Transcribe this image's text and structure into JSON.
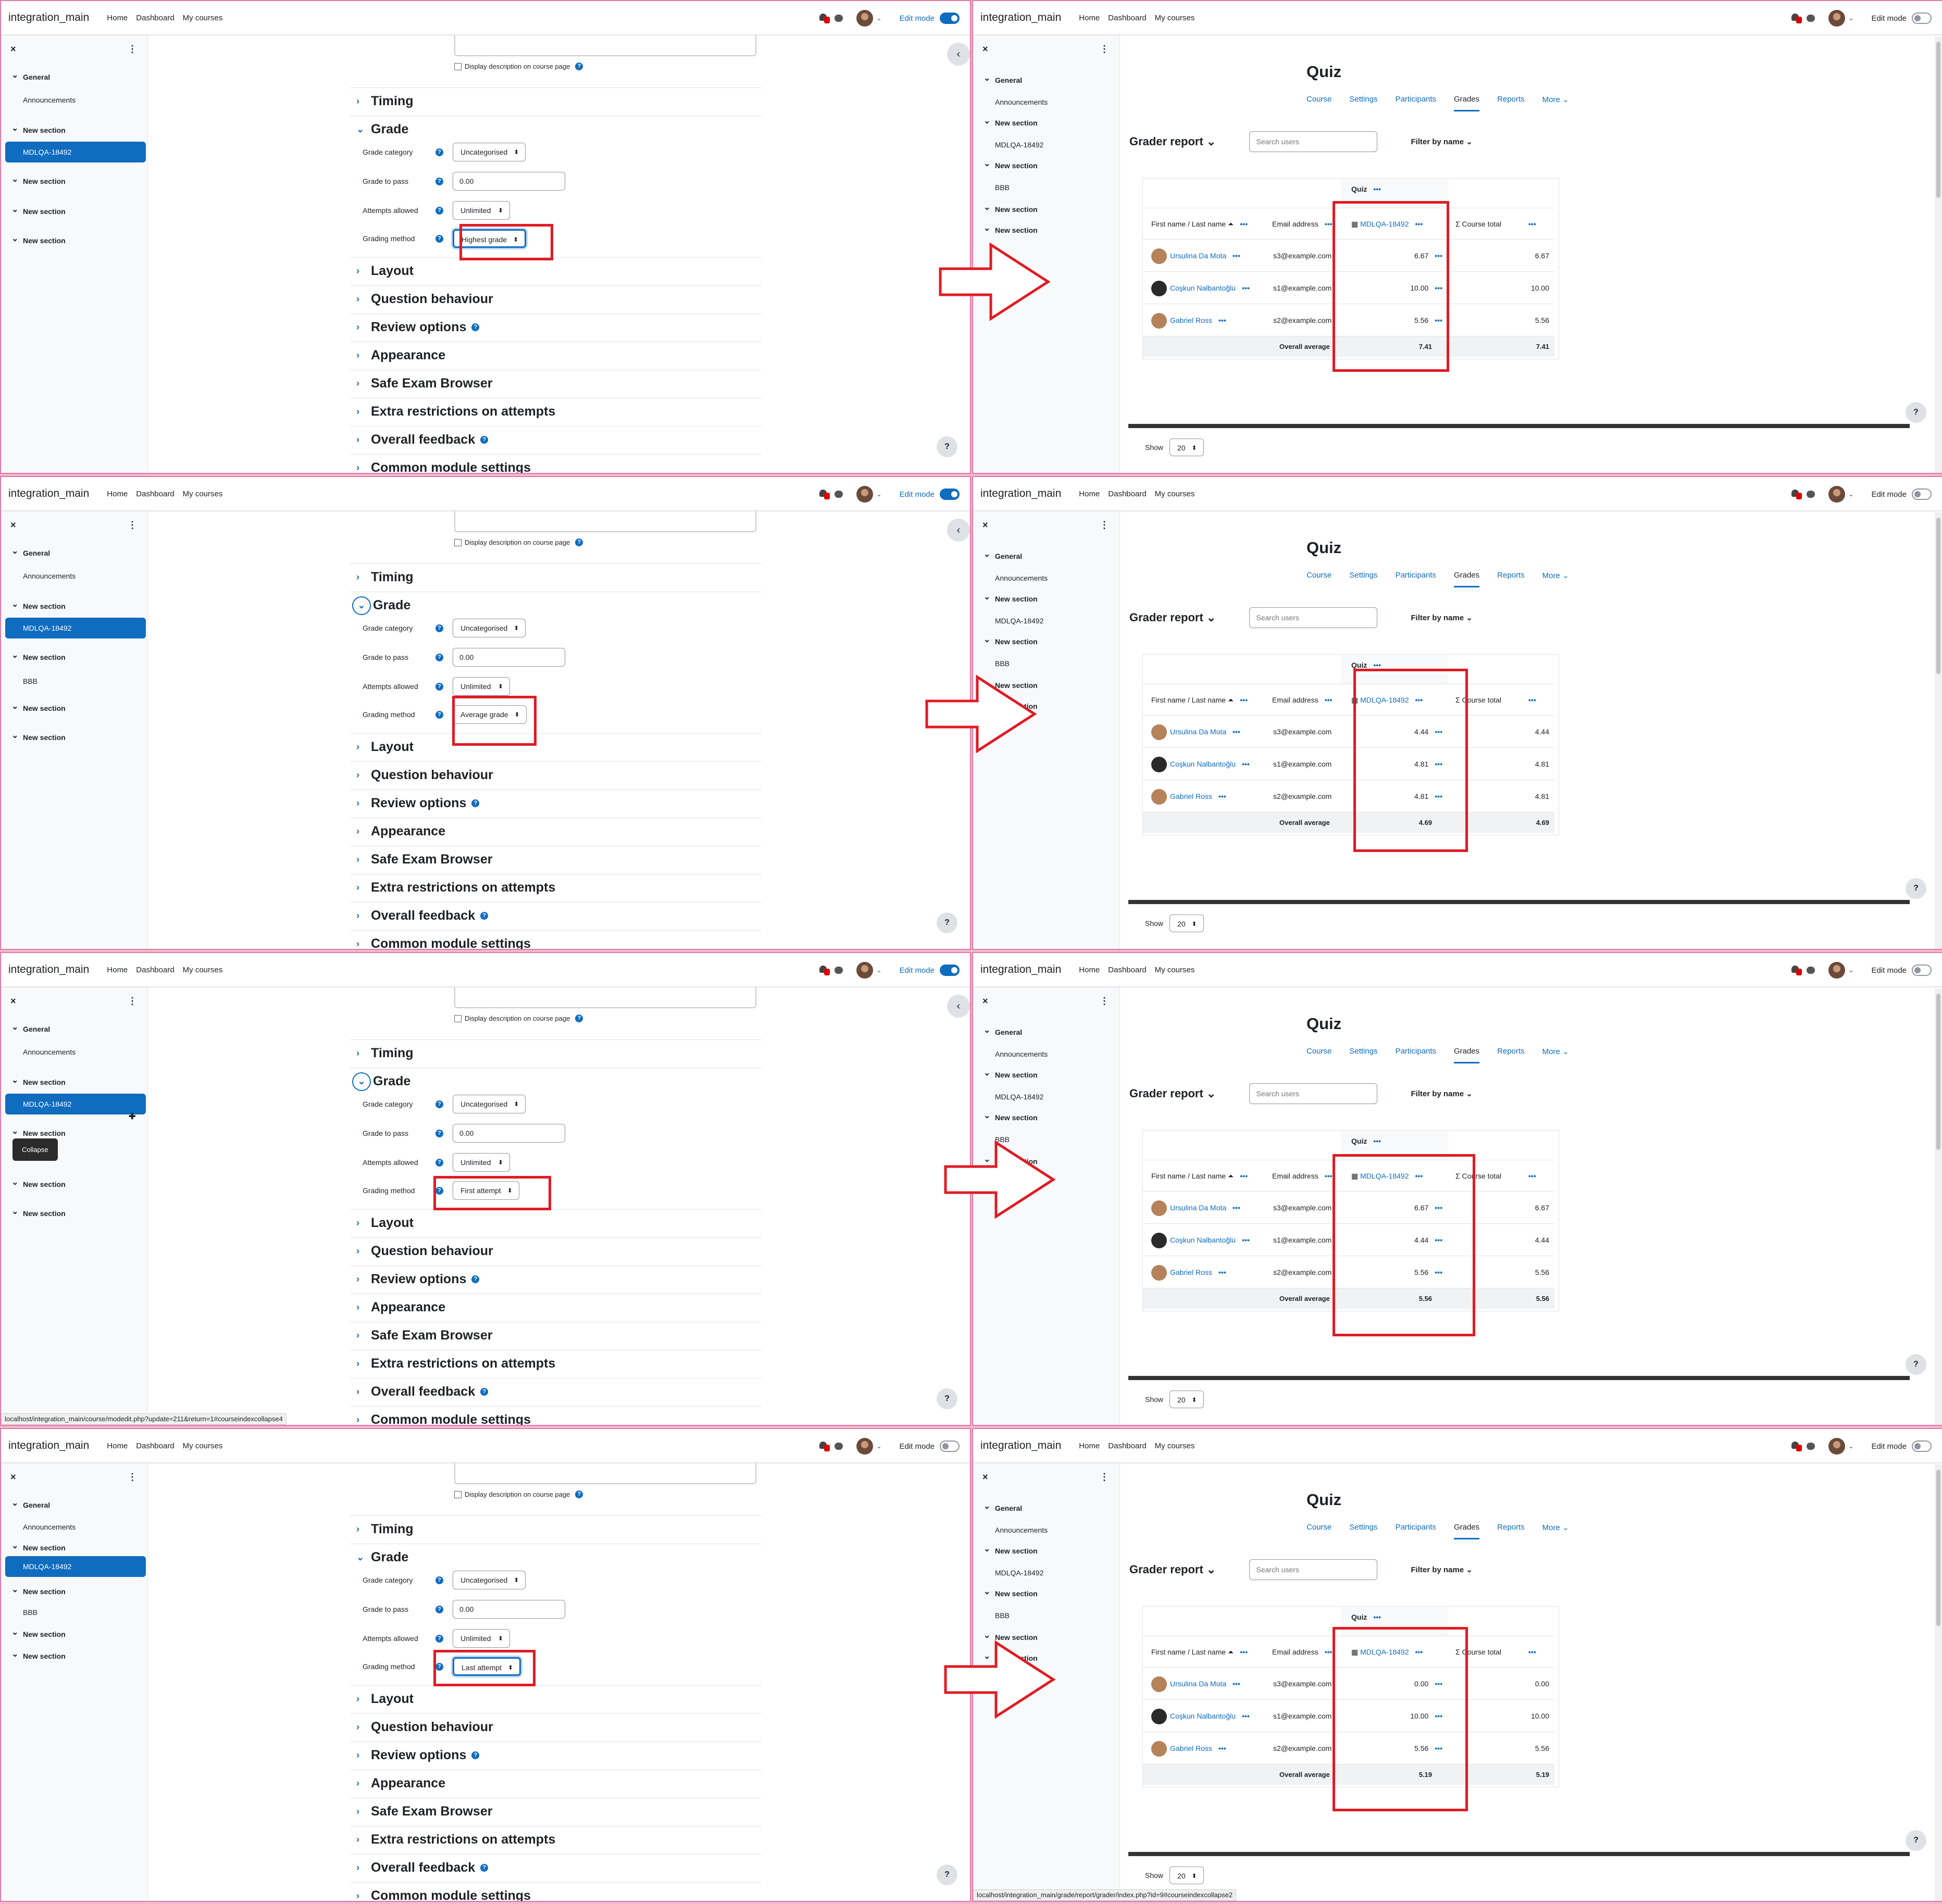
{
  "common": {
    "site_name": "integration_main",
    "nav": [
      "Home",
      "Dashboard",
      "My courses"
    ],
    "edit_mode": "Edit mode",
    "close": "×",
    "kebab": "⋮",
    "display_description": "Display description on course page",
    "sections": [
      "Timing",
      "Grade",
      "Layout",
      "Question behaviour",
      "Review options",
      "Appearance",
      "Safe Exam Browser",
      "Extra restrictions on attempts",
      "Overall feedback",
      "Common module settings"
    ],
    "labels": {
      "grade_category": "Grade category",
      "grade_to_pass": "Grade to pass",
      "attempts_allowed": "Attempts allowed",
      "grading_method": "Grading method"
    },
    "values": {
      "grade_category": "Uncategorised",
      "grade_to_pass": "0.00",
      "attempts_allowed": "Unlimited"
    },
    "course_index": {
      "general": "General",
      "announcements": "Announcements",
      "new_section": "New section",
      "quiz": "MDLQA-18492",
      "bbb": "BBB"
    },
    "collapse_tooltip": "Collapse",
    "help": "?",
    "quiz_title": "Quiz",
    "tabs": [
      "Course",
      "Settings",
      "Participants",
      "Grades",
      "Reports",
      "More ⌄"
    ],
    "grader_report": "Grader report ⌄",
    "search_placeholder": "Search users",
    "filter_by_name": "Filter by name ⌄",
    "col_name": "First name / Last name ⏶",
    "col_email": "Email address",
    "col_quiz_group": "Quiz",
    "col_quiz_item": "MDLQA-18492",
    "col_course_total": "Course total",
    "overall_average": "Overall average",
    "show": "Show",
    "show_value": "20",
    "students": [
      {
        "name": "Ursulina Da Mota",
        "email": "s3@example.com"
      },
      {
        "name": "Coşkun Nalbantoğlu",
        "email": "s1@example.com"
      },
      {
        "name": "Gabriel Ross",
        "email": "s2@example.com"
      }
    ]
  },
  "rows": [
    {
      "grading_method": "Highest grade",
      "grades": [
        "6.67",
        "10.00",
        "5.56"
      ],
      "average": "7.41"
    },
    {
      "grading_method": "Average grade",
      "grades": [
        "4.44",
        "4.81",
        "4.81"
      ],
      "average": "4.69"
    },
    {
      "grading_method": "First attempt",
      "grades": [
        "6.67",
        "4.44",
        "5.56"
      ],
      "average": "5.56"
    },
    {
      "grading_method": "Last attempt",
      "grades": [
        "0.00",
        "10.00",
        "5.56"
      ],
      "average": "5.19"
    }
  ],
  "status_urls": {
    "row3_left": "localhost/integration_main/course/modedit.php?update=211&return=1#courseindexcollapse4",
    "row4_right": "localhost/integration_main/grade/report/grader/index.php?id=9#courseindexcollapse2"
  },
  "colors": {
    "accent": "#0f6cbf",
    "annotation": "#e01b24",
    "separator": "#f4b9cf"
  }
}
